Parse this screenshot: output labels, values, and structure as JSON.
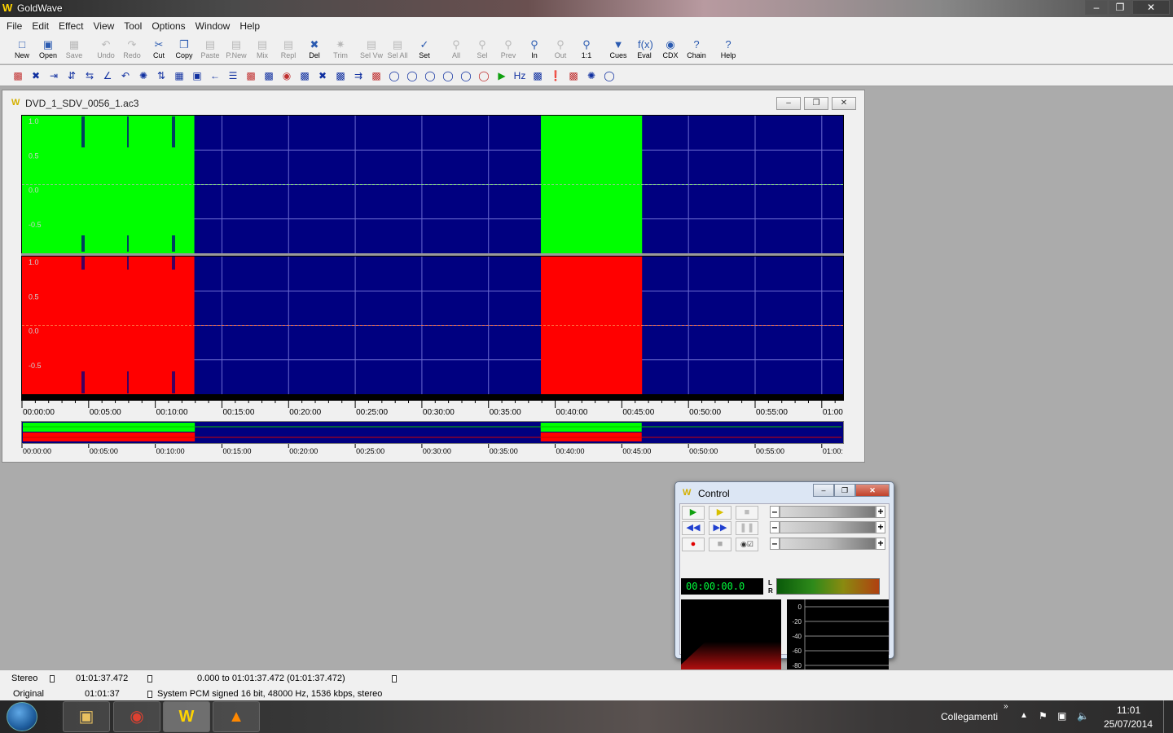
{
  "app": {
    "title": "GoldWave",
    "icon": "goldwave-icon"
  },
  "menu": [
    "File",
    "Edit",
    "Effect",
    "View",
    "Tool",
    "Options",
    "Window",
    "Help"
  ],
  "toolbar": [
    {
      "label": "New",
      "icon": "new-file-icon",
      "enabled": true
    },
    {
      "label": "Open",
      "icon": "open-folder-icon",
      "enabled": true
    },
    {
      "label": "Save",
      "icon": "save-icon",
      "enabled": false
    },
    {
      "label": "Undo",
      "icon": "undo-icon",
      "enabled": false
    },
    {
      "label": "Redo",
      "icon": "redo-icon",
      "enabled": false
    },
    {
      "label": "Cut",
      "icon": "scissors-icon",
      "enabled": true
    },
    {
      "label": "Copy",
      "icon": "copy-icon",
      "enabled": true
    },
    {
      "label": "Paste",
      "icon": "paste-icon",
      "enabled": false
    },
    {
      "label": "P.New",
      "icon": "paste-new-icon",
      "enabled": false
    },
    {
      "label": "Mix",
      "icon": "mix-icon",
      "enabled": false
    },
    {
      "label": "Repl",
      "icon": "replace-icon",
      "enabled": false
    },
    {
      "label": "Del",
      "icon": "delete-icon",
      "enabled": true
    },
    {
      "label": "Trim",
      "icon": "trim-icon",
      "enabled": false
    },
    {
      "label": "Sel Vw",
      "icon": "select-view-icon",
      "enabled": false
    },
    {
      "label": "Sel All",
      "icon": "select-all-icon",
      "enabled": false
    },
    {
      "label": "Set",
      "icon": "set-marker-icon",
      "enabled": true
    },
    {
      "label": "All",
      "icon": "zoom-all-icon",
      "enabled": false
    },
    {
      "label": "Sel",
      "icon": "zoom-selection-icon",
      "enabled": false
    },
    {
      "label": "Prev",
      "icon": "zoom-previous-icon",
      "enabled": false
    },
    {
      "label": "In",
      "icon": "zoom-in-icon",
      "enabled": true
    },
    {
      "label": "Out",
      "icon": "zoom-out-icon",
      "enabled": false
    },
    {
      "label": "1:1",
      "icon": "zoom-one-icon",
      "enabled": true
    },
    {
      "label": "Cues",
      "icon": "cues-icon",
      "enabled": true
    },
    {
      "label": "Eval",
      "icon": "eval-icon",
      "enabled": true
    },
    {
      "label": "CDX",
      "icon": "cdx-icon",
      "enabled": true
    },
    {
      "label": "Chain",
      "icon": "chain-icon",
      "enabled": true
    },
    {
      "label": "Help",
      "icon": "help-icon",
      "enabled": true
    }
  ],
  "effects_toolbar_count": 34,
  "document": {
    "title": "DVD_1_SDV_0056_1.ac3",
    "amplitude_labels": [
      "1.0",
      "0.5",
      "0.0",
      "-0.5"
    ],
    "time_ticks": [
      "00:00:00",
      "00:05:00",
      "00:10:00",
      "00:15:00",
      "00:20:00",
      "00:25:00",
      "00:30:00",
      "00:35:00",
      "00:40:00",
      "00:45:00",
      "00:50:00",
      "00:55:00",
      "01:00"
    ],
    "overview_ticks": [
      "00:00:00",
      "00:05:00",
      "00:10:00",
      "00:15:00",
      "00:20:00",
      "00:25:00",
      "00:30:00",
      "00:35:00",
      "00:40:00",
      "00:45:00",
      "00:50:00",
      "00:55:00",
      "01:00:"
    ],
    "audio_segments_minutes": [
      [
        0,
        12.93
      ],
      [
        38.93,
        46.52
      ]
    ],
    "visible_range_minutes": [
      0,
      61.6
    ],
    "colors": {
      "background": "#000080",
      "left_channel": "#00ff00",
      "right_channel": "#ff0000",
      "grid": "#6a6ad0"
    }
  },
  "control": {
    "title": "Control",
    "time": "00:00:00.0",
    "meter_labels": [
      "L",
      "R"
    ],
    "db_labels": [
      "0",
      "-20",
      "-40",
      "-60",
      "-80"
    ]
  },
  "status": {
    "channels": "Stereo",
    "length": "01:01:37.472",
    "selection": "0.000 to 01:01:37.472 (01:01:37.472)",
    "mode": "Original",
    "position": "01:01:37",
    "format": "System PCM signed 16 bit, 48000 Hz, 1536 kbps, stereo"
  },
  "taskbar": {
    "toolbar_label": "Collegamenti",
    "clock_time": "11:01",
    "clock_date": "25/07/2014"
  }
}
